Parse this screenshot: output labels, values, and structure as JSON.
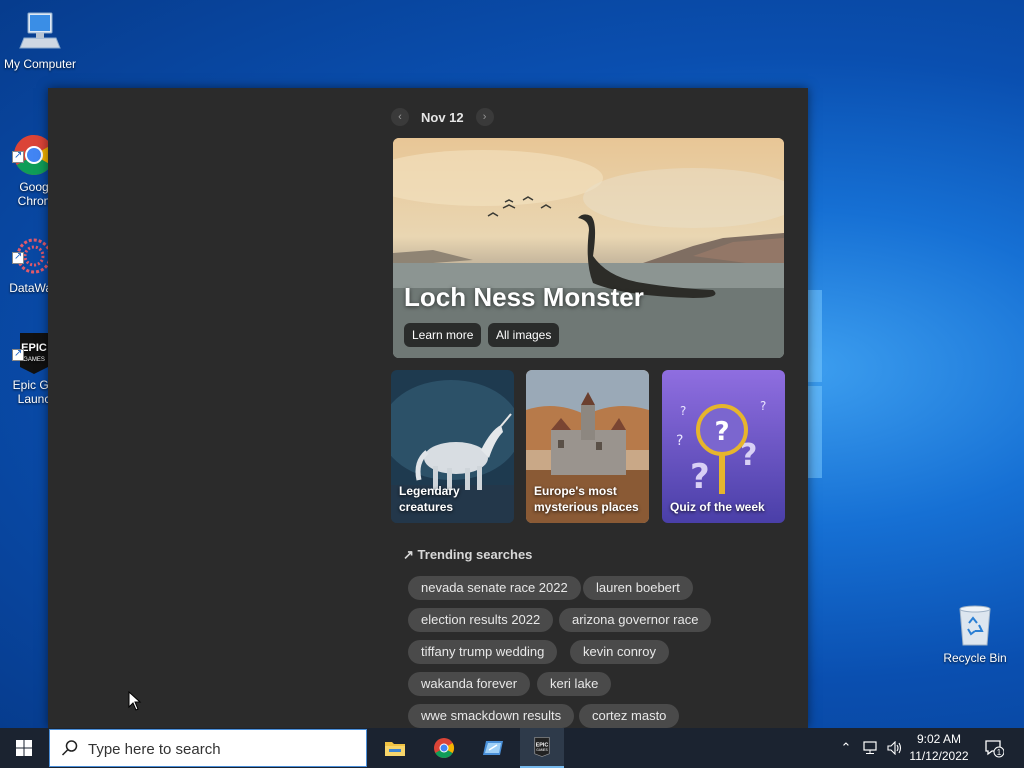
{
  "desktop": {
    "icons": [
      {
        "label": "My Computer",
        "icon": "computer-icon"
      },
      {
        "label": "Goog\nChron",
        "icon": "chrome-icon"
      },
      {
        "label": "DataWag",
        "icon": "datawagon-icon"
      },
      {
        "label": "Epic Ga\nLaunc",
        "icon": "epic-games-icon"
      }
    ],
    "recycle_bin": {
      "label": "Recycle Bin",
      "icon": "recycle-bin-icon"
    }
  },
  "search_panel": {
    "date": "Nov 12",
    "hero": {
      "title": "Loch Ness Monster",
      "buttons": [
        "Learn more",
        "All images"
      ]
    },
    "cards": [
      {
        "label": "Legendary creatures"
      },
      {
        "label": "Europe's most mysterious places"
      },
      {
        "label": "Quiz of the week"
      }
    ],
    "trending": {
      "heading": "Trending searches",
      "items": [
        "nevada senate race 2022",
        "lauren boebert",
        "election results 2022",
        "arizona governor race",
        "tiffany trump wedding",
        "kevin conroy",
        "wakanda forever",
        "keri lake",
        "wwe smackdown results",
        "cortez masto"
      ]
    }
  },
  "taskbar": {
    "search_placeholder": "Type here to search",
    "apps": [
      "file-explorer-icon",
      "chrome-icon",
      "app-icon",
      "epic-games-icon"
    ],
    "clock": {
      "time": "9:02 AM",
      "date": "11/12/2022"
    },
    "notification_count": "1"
  },
  "colors": {
    "panel_bg": "#2b2b2b",
    "chip_bg": "#4a4a4a",
    "taskbar_bg": "#1b2330",
    "desktop_blue": "#0a4fb0"
  }
}
